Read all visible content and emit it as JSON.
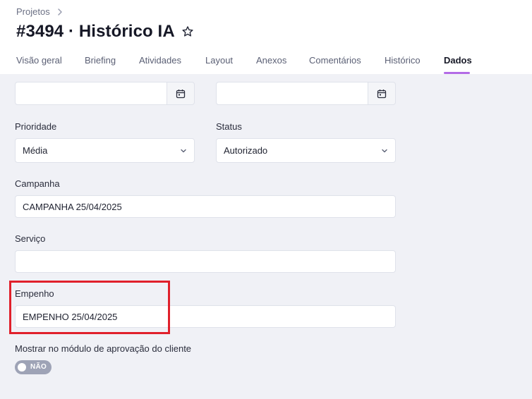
{
  "breadcrumb": {
    "root": "Projetos"
  },
  "page": {
    "title": "#3494 · Histórico IA"
  },
  "tabs": [
    {
      "label": "Visão geral"
    },
    {
      "label": "Briefing"
    },
    {
      "label": "Atividades"
    },
    {
      "label": "Layout"
    },
    {
      "label": "Anexos"
    },
    {
      "label": "Comentários"
    },
    {
      "label": "Histórico"
    },
    {
      "label": "Dados"
    }
  ],
  "active_tab": "Dados",
  "form": {
    "date_start": {
      "value": ""
    },
    "date_end": {
      "value": ""
    },
    "prioridade": {
      "label": "Prioridade",
      "value": "Média"
    },
    "status": {
      "label": "Status",
      "value": "Autorizado"
    },
    "campanha": {
      "label": "Campanha",
      "value": "CAMPANHA 25/04/2025"
    },
    "servico": {
      "label": "Serviço",
      "value": ""
    },
    "empenho": {
      "label": "Empenho",
      "value": "EMPENHO 25/04/2025"
    },
    "mostrar_modulo": {
      "label": "Mostrar no módulo de aprovação do cliente",
      "toggle_text": "NÃO",
      "enabled": false
    }
  },
  "colors": {
    "accent": "#b36be6",
    "highlight": "#e0202b",
    "toggle_off": "#9ea3b6"
  }
}
